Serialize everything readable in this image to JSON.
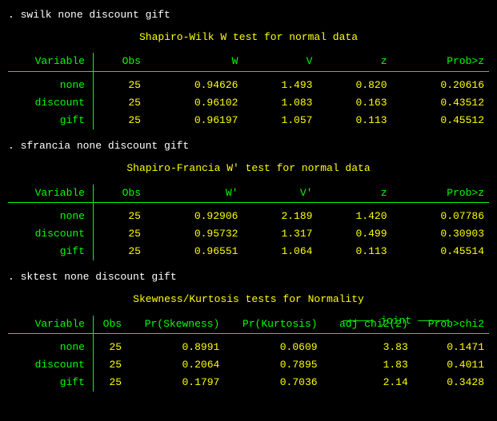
{
  "cmd1": ". swilk  none discount gift",
  "cmd2": ". sfrancia  none discount gift",
  "cmd3": ". sktest  none discount gift",
  "swilk": {
    "title": "Shapiro-Wilk W test for normal data",
    "headers": {
      "var": "Variable",
      "obs": "Obs",
      "w": "W",
      "v": "V",
      "z": "z",
      "p": "Prob>z"
    },
    "rows": [
      {
        "var": "none",
        "obs": "25",
        "w": "0.94626",
        "v": "1.493",
        "z": "0.820",
        "p": "0.20616"
      },
      {
        "var": "discount",
        "obs": "25",
        "w": "0.96102",
        "v": "1.083",
        "z": "0.163",
        "p": "0.43512"
      },
      {
        "var": "gift",
        "obs": "25",
        "w": "0.96197",
        "v": "1.057",
        "z": "0.113",
        "p": "0.45512"
      }
    ]
  },
  "sfrancia": {
    "title": "Shapiro-Francia W' test for normal data",
    "headers": {
      "var": "Variable",
      "obs": "Obs",
      "w": "W'",
      "v": "V'",
      "z": "z",
      "p": "Prob>z"
    },
    "rows": [
      {
        "var": "none",
        "obs": "25",
        "w": "0.92906",
        "v": "2.189",
        "z": "1.420",
        "p": "0.07786"
      },
      {
        "var": "discount",
        "obs": "25",
        "w": "0.95732",
        "v": "1.317",
        "z": "0.499",
        "p": "0.30903"
      },
      {
        "var": "gift",
        "obs": "25",
        "w": "0.96551",
        "v": "1.064",
        "z": "0.113",
        "p": "0.45514"
      }
    ]
  },
  "sktest": {
    "title": "Skewness/Kurtosis tests for Normality",
    "joint": "joint",
    "joint_decor_l": "—————",
    "joint_decor_r": "—————",
    "headers": {
      "var": "Variable",
      "obs": "Obs",
      "skew": "Pr(Skewness)",
      "kurt": "Pr(Kurtosis)",
      "chi": "adj chi2(2)",
      "p": "Prob>chi2"
    },
    "rows": [
      {
        "var": "none",
        "obs": "25",
        "skew": "0.8991",
        "kurt": "0.0609",
        "chi": "3.83",
        "p": "0.1471"
      },
      {
        "var": "discount",
        "obs": "25",
        "skew": "0.2064",
        "kurt": "0.7895",
        "chi": "1.83",
        "p": "0.4011"
      },
      {
        "var": "gift",
        "obs": "25",
        "skew": "0.1797",
        "kurt": "0.7036",
        "chi": "2.14",
        "p": "0.3428"
      }
    ]
  }
}
